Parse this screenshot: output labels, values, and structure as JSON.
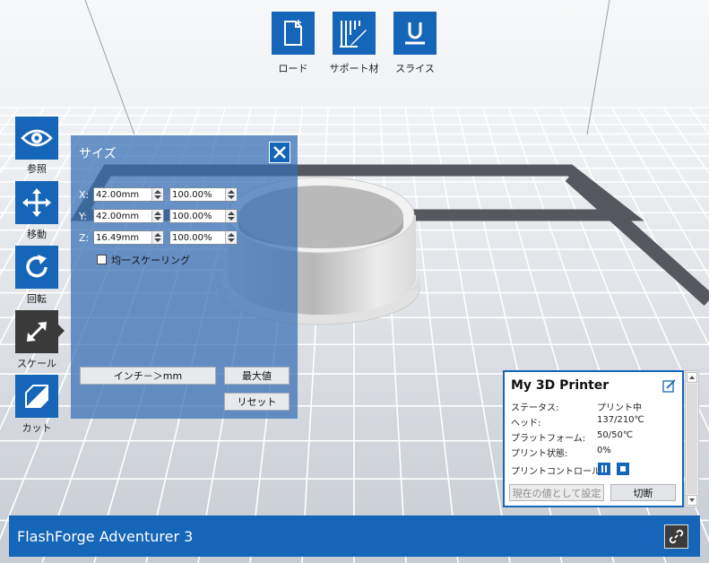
{
  "colors": {
    "accent": "#1565b8",
    "active": "#3a3a3a",
    "panel": "#346eb4"
  },
  "top_toolbar": [
    {
      "name": "load",
      "label": "ロード",
      "icon": "file-plus-icon"
    },
    {
      "name": "support",
      "label": "サポート材",
      "icon": "support-pencil-icon"
    },
    {
      "name": "slice",
      "label": "スライス",
      "icon": "slice-icon"
    }
  ],
  "left_toolbar": [
    {
      "name": "view",
      "label": "参照",
      "icon": "eye-icon",
      "active": false
    },
    {
      "name": "move",
      "label": "移動",
      "icon": "move-arrows-icon",
      "active": false
    },
    {
      "name": "rotate",
      "label": "回転",
      "icon": "rotate-icon",
      "active": false
    },
    {
      "name": "scale",
      "label": "スケール",
      "icon": "scale-arrow-icon",
      "active": true
    },
    {
      "name": "cut",
      "label": "カット",
      "icon": "cut-icon",
      "active": false
    }
  ],
  "size_panel": {
    "title": "サイズ",
    "rows": [
      {
        "axis": "X:",
        "size": "42.00mm",
        "percent": "100.00%"
      },
      {
        "axis": "Y:",
        "size": "42.00mm",
        "percent": "100.00%"
      },
      {
        "axis": "Z:",
        "size": "16.49mm",
        "percent": "100.00%"
      }
    ],
    "uniform_scaling_label": "均一スケーリング",
    "uniform_scaling_checked": false,
    "inch_to_mm_label": "インチ－＞mm",
    "max_label": "最大値",
    "reset_label": "リセット"
  },
  "printer": {
    "name": "My 3D Printer",
    "fields": [
      {
        "label": "ステータス:",
        "value": "プリント中"
      },
      {
        "label": "ヘッド:",
        "value": "137/210℃"
      },
      {
        "label": "プラットフォーム:",
        "value": "50/50℃"
      },
      {
        "label": "プリント状態:",
        "value": "0%"
      }
    ],
    "control_label": "プリントコントロール:",
    "set_current_label": "現在の値として設定",
    "disconnect_label": "切断"
  },
  "footer": {
    "title": "FlashForge Adventurer 3"
  }
}
